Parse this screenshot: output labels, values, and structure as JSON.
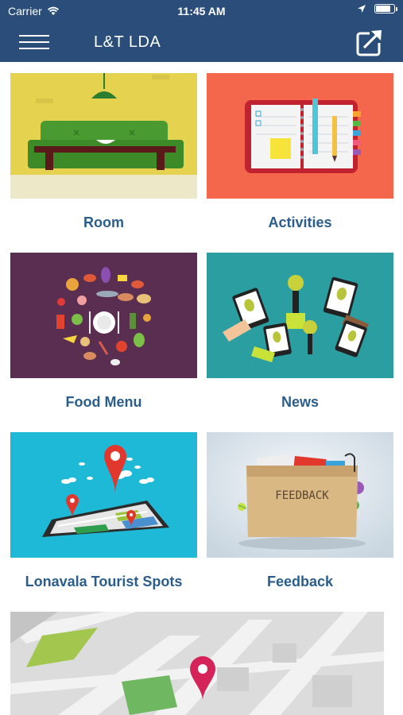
{
  "status_bar": {
    "carrier": "Carrier",
    "time": "11:45 AM",
    "battery_level": 0.85
  },
  "nav": {
    "title": "L&T LDA",
    "menu_icon": "hamburger-menu-icon",
    "share_icon": "share-icon"
  },
  "tiles": [
    {
      "label": "Room"
    },
    {
      "label": "Activities"
    },
    {
      "label": "Food Menu"
    },
    {
      "label": "News"
    },
    {
      "label": "Lonavala Tourist Spots"
    },
    {
      "label": "Feedback",
      "image_text": "FEEDBACK"
    }
  ],
  "colors": {
    "nav_bg": "#2a4e79",
    "label": "#2a5d8c",
    "room_bg": "#e5d24f",
    "activities_bg": "#f5674c",
    "food_bg": "#5a2e50",
    "news_bg": "#2b9ea2",
    "tourist_bg": "#1fb9d8",
    "feedback_bg": "#dde6ed"
  }
}
